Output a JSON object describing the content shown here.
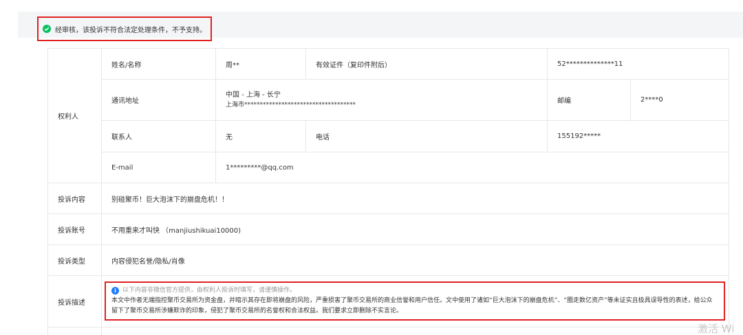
{
  "status": {
    "message": "经审核，该投诉不符合法定处理条件，不予支持。"
  },
  "rights_holder": {
    "section_label": "权利人",
    "name_label": "姓名/名称",
    "name_value": "周**",
    "id_label": "有效证件（复印件附后）",
    "id_value": "52**************11",
    "address_label": "通讯地址",
    "address_line1": "中国 - 上海 - 长宁",
    "address_line2": "上海市************************************",
    "postcode_label": "邮编",
    "postcode_value": "2****0",
    "contact_label": "联系人",
    "contact_value": "无",
    "phone_label": "电话",
    "phone_value": "155192*****",
    "email_label": "E-mail",
    "email_value": "1*********@qq.com"
  },
  "complaint": {
    "content_label": "投诉内容",
    "content_value": "别碰聚币！巨大泡沫下的崩盘危机！！",
    "account_label": "投诉账号",
    "account_value": "不用重来才叫快 （manjiushikuai10000)",
    "type_label": "投诉类型",
    "type_value": "内容侵犯名誉/隐私/肖像",
    "desc_label": "投诉描述",
    "desc_notice": "以下内容非微信官方提供，由权利人投诉时填写，请谨慎操作。",
    "desc_text": "本文中作者无端指控聚币交易所为资金盘，并暗示其存在即将崩盘的风险，严重损害了聚币交易所的商业信誉和用户信任。文中使用了诸如“巨大泡沫下的崩盘危机”、“圈走数亿资产”等未证实且极具误导性的表述，给公众留下了聚币交易所涉嫌欺诈的印象，侵犯了聚币交易所的名誉权和合法权益。我们要求立即删除不实言论。"
  },
  "watermark": "激活 Wi"
}
